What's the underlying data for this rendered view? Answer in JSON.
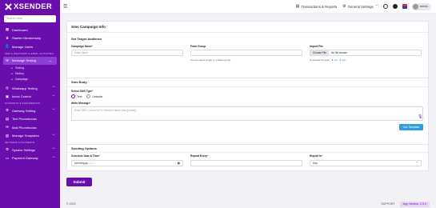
{
  "sidebar": {
    "brand": "XSENDER",
    "search_placeholder": "Search Here",
    "items": [
      {
        "label": "Dashboard",
        "icon": "grid-icon"
      },
      {
        "label": "Startter Membership",
        "icon": "crown-icon"
      },
      {
        "label": "Manage Users",
        "icon": "user-icon"
      }
    ],
    "section_1": "SMS & WHATSAPP & EMAIL ACTIVITIES",
    "messaging": {
      "label": "Message Texting",
      "sub": [
        "Texting",
        "History",
        "Campaign"
      ]
    },
    "items_2": [
      {
        "label": "Whatsapp Texting",
        "icon": "whatsapp-icon"
      },
      {
        "label": "Inbox Control",
        "icon": "inbox-icon"
      }
    ],
    "section_2": "GATEWAYS & PHONEBOOKS",
    "items_3": [
      {
        "label": "Gateway Setting",
        "icon": "gateway-icon"
      },
      {
        "label": "Text Phonebooks",
        "icon": "book-icon"
      },
      {
        "label": "Mail Phonebooks",
        "icon": "mail-icon"
      },
      {
        "label": "Manage Templates",
        "icon": "template-icon"
      }
    ],
    "section_3": "SETTINGS & PAYMENTS",
    "items_4": [
      {
        "label": "System Settings",
        "icon": "settings-icon"
      },
      {
        "label": "Payment Gateway",
        "icon": "payment-icon"
      }
    ]
  },
  "topbar": {
    "transactions": "Transactions & Reports",
    "general_settings": "General Settings",
    "admin": "admin"
  },
  "page": {
    "title": "Sms Campaign Info",
    "target": {
      "heading": "Set Target Audience",
      "campaign_name_label": "Campaign Name",
      "campaign_name_placeholder": "Enter Name",
      "from_group_label": "From Group",
      "from_group_hint": "Can be select single or multiple group",
      "import_file_label": "Import File",
      "choose_file": "Choose File",
      "no_file": "No file chosen",
      "download_sample": "Download Sample:",
      "csv": "csv",
      "xlsx": "xlsx"
    },
    "body": {
      "heading": "Sms Body",
      "select_type_label": "Select SMS Type",
      "text_option": "Text",
      "unicode_option": "Unicode",
      "write_message_label": "Write Message",
      "message_placeholder": "Enter SMS Content & For Mention Name Use {{name}}",
      "use_template": "Use Template"
    },
    "sending": {
      "heading": "Sending Options",
      "schedule_label": "Schedule Date & Time",
      "schedule_value": "mm/dd/yyyy --:-- --",
      "repeat_every_label": "Repeat Every",
      "repeat_in_label": "Repeat In",
      "repeat_in_value": "Day"
    },
    "submit": "Submit"
  },
  "footer": {
    "copyright": "© 2022",
    "support": "SUPPORT",
    "version": "App Version: 2.0.0"
  }
}
